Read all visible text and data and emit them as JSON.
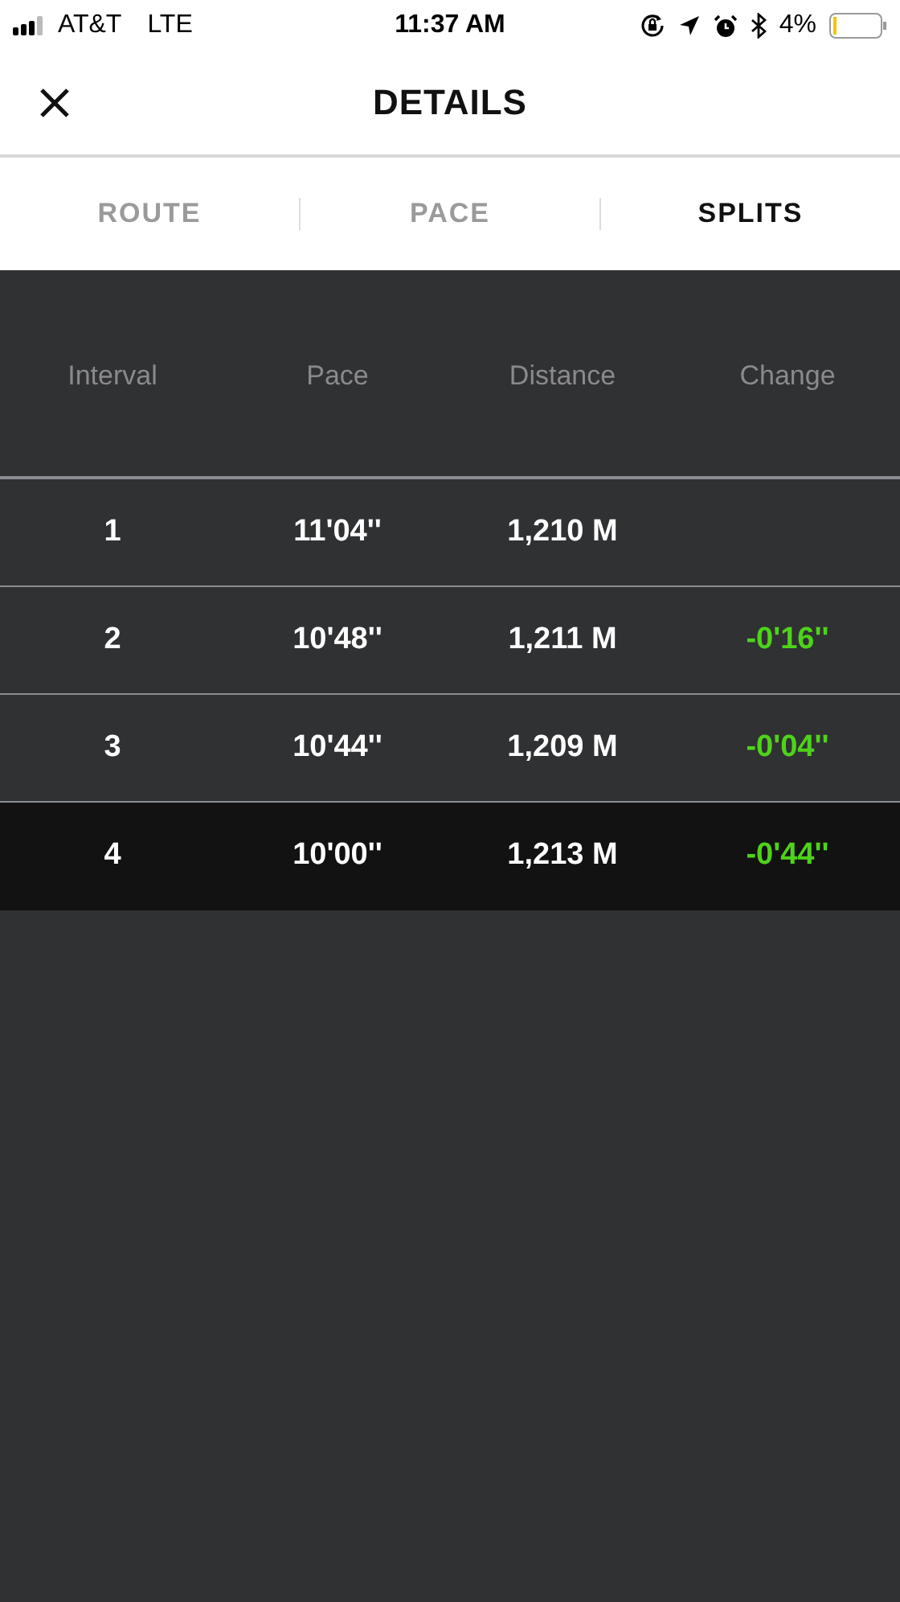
{
  "status_bar": {
    "carrier": "AT&T",
    "network": "LTE",
    "time": "11:37 AM",
    "battery": "4%"
  },
  "header": {
    "title": "DETAILS"
  },
  "tabs": [
    {
      "label": "ROUTE",
      "selected": false
    },
    {
      "label": "PACE",
      "selected": false
    },
    {
      "label": "SPLITS",
      "selected": true
    }
  ],
  "table": {
    "columns": [
      "Interval",
      "Pace",
      "Distance",
      "Change"
    ],
    "rows": [
      {
        "interval": "1",
        "pace": "11'04''",
        "distance": "1,210 M",
        "selected": false
      },
      {
        "interval": "2",
        "pace": "10'48''",
        "distance": "1,211 M",
        "change": "-0'16''",
        "selected": false
      },
      {
        "interval": "3",
        "pace": "10'44''",
        "distance": "1,209 M",
        "change": "-0'04''",
        "selected": false
      },
      {
        "interval": "4",
        "pace": "10'00''",
        "distance": "1,213 M",
        "change": "-0'44''",
        "selected": true
      }
    ]
  }
}
